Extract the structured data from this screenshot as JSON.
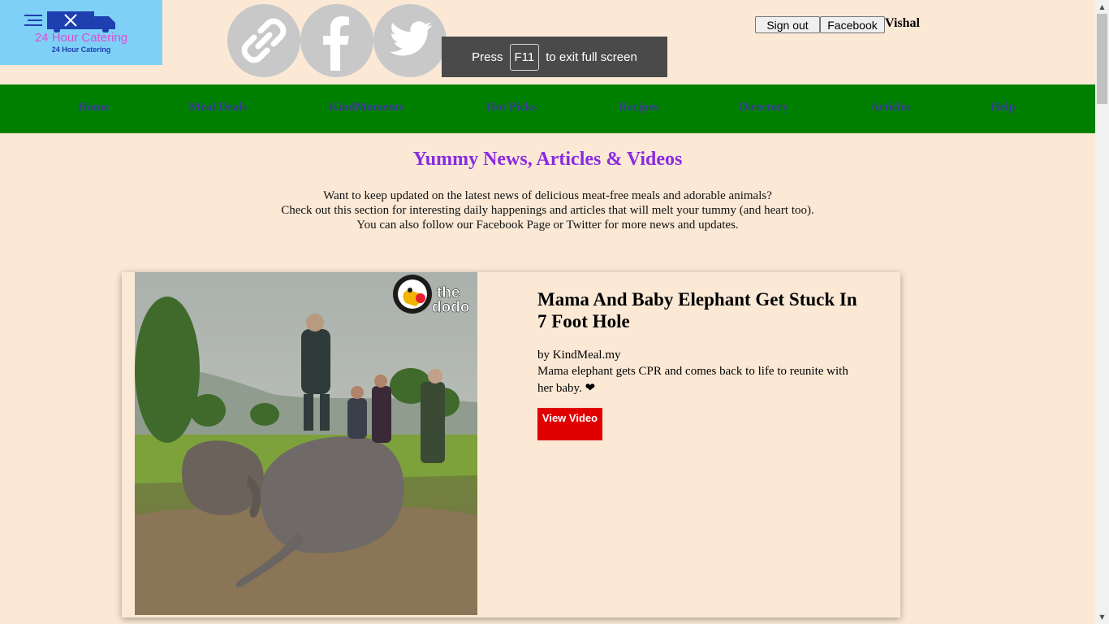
{
  "logo": {
    "title": "24 Hour Catering",
    "subtitle": "24 Hour Catering"
  },
  "social": [
    {
      "icon": "link-icon"
    },
    {
      "icon": "facebook-icon"
    },
    {
      "icon": "twitter-icon"
    }
  ],
  "fullscreen_notice": {
    "prefix": "Press",
    "key": "F11",
    "suffix": "to exit full screen"
  },
  "auth": {
    "sign_out_label": "Sign out",
    "facebook_label": "Facebook",
    "username": "Vishal"
  },
  "nav": {
    "home": "Home",
    "meal_deals": "Meal Deals",
    "kindmoments": "KindMoments",
    "hot_picks": "Hot Picks",
    "recipes": "Recipes",
    "directory": "Directory",
    "articles": "Articles",
    "help": "Help"
  },
  "main": {
    "heading": "Yummy News, Articles & Videos",
    "intro": [
      "Want to keep updated on the latest news of delicious meat-free meals and adorable animals?",
      "Check out this section for interesting daily happenings and articles that will melt your tummy (and heart too).",
      "You can also follow our Facebook Page or Twitter for more news and updates."
    ]
  },
  "article": {
    "title": "Mama And Baby Elephant Get Stuck In 7 Foot Hole",
    "byline": "by KindMeal.my",
    "description": "Mama elephant gets CPR and comes back to life to reunite with her baby. ❤",
    "button_label": "View Video",
    "watermark_line1": "the",
    "watermark_line2": "dodo"
  },
  "colors": {
    "background": "#fbe9d6",
    "nav_bg": "#008000",
    "nav_link": "#3a3a9a",
    "heading": "#8a2be2",
    "button": "#e00000",
    "logo_bg": "#7fd0f7"
  }
}
